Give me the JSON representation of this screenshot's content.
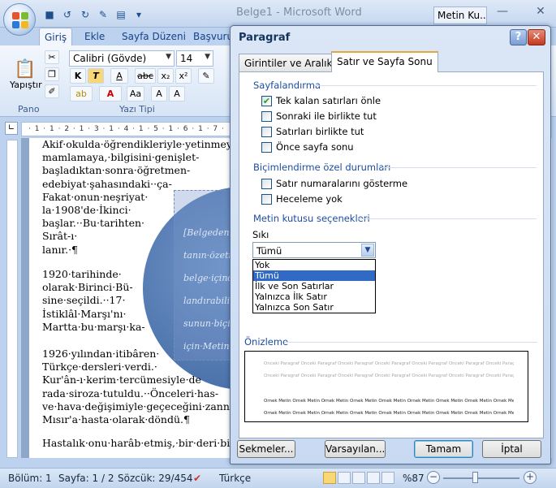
{
  "window": {
    "title": "Belge1 - Microsoft Word",
    "taskbar_label": "Metin Ku..."
  },
  "ribbon": {
    "tabs": [
      "Giriş",
      "Ekle",
      "Sayfa Düzeni",
      "Başvuru"
    ],
    "font_name": "Calibri (Gövde)",
    "font_size": "14",
    "paste_label": "Yapıştır",
    "group_clipboard": "Pano",
    "group_font": "Yazı Tipi"
  },
  "document": {
    "lines_a": [
      "Akif·okulda·öğrendikleriyle·yetinmeyerek",
      "mamlamaya,·bilgisini·genişlet-",
      "başladıktan·sonra·öğretmen-",
      "edebiyat·şahasındaki··ça-",
      "Fakat·onun·neşriyat·",
      "la·1908'de·İkinci·",
      "başlar.··Bu·tarihten·",
      "Sırât-ı·",
      "lanır.·¶"
    ],
    "lines_b": [
      "1920·tarihinde·",
      "olarak·Birinci·Bü-",
      "sine·seçildi.··17·",
      "İstiklâl·Marşı'nı·",
      "Martta·bu·marşı·ka-"
    ],
    "lines_c": [
      "1926·yılından·itibâren·",
      "Türkçe·dersleri·verdi.·",
      "Kur'ân-ı·kerim·tercümesiyle·de",
      "rada·siroza·tutuldu.··Önceleri·has-",
      "ve·hava·değişimiyle·geçeceğini·zannetti.·",
      "Mısır'a·hasta·olarak·döndü.¶"
    ],
    "line_d": "Hastalık·onu·harâb·etmiş,·bir·deri·bir·kem",
    "textbox_lines": [
      "[Belgeden·bi",
      "tanın·özetir",
      "belge·içinde",
      "landırabilirsi",
      "sunun·biçim",
      "için·Metin·K"
    ]
  },
  "status": {
    "section": "Bölüm: 1",
    "page": "Sayfa: 1 / 2",
    "words": "Sözcük: 29/454",
    "language": "Türkçe",
    "zoom": "%87",
    "zoom_level_percent": 87
  },
  "dialog": {
    "title": "Paragraf",
    "help_label": "?",
    "close_label": "✕",
    "tabs": [
      "Girintiler ve Aralıklar",
      "Satır ve Sayfa Sonu"
    ],
    "sec_pagination": "Sayfalandırma",
    "pagination": [
      {
        "label": "Tek kalan satırları önle",
        "checked": true
      },
      {
        "label": "Sonraki ile birlikte tut",
        "checked": false
      },
      {
        "label": "Satırları birlikte tut",
        "checked": false
      },
      {
        "label": "Önce sayfa sonu",
        "checked": false
      }
    ],
    "sec_formatting": "Biçimlendirme özel durumları",
    "formatting": [
      {
        "label": "Satır numaralarını gösterme",
        "checked": false
      },
      {
        "label": "Heceleme yok",
        "checked": false
      }
    ],
    "sec_textbox": "Metin kutusu seçenekleri",
    "tight_wrap_label": "Sıkı kaydırma:",
    "tight_wrap_value": "Tümü",
    "tight_wrap_options": [
      "Yok",
      "Tümü",
      "İlk ve Son Satırlar",
      "Yalnızca İlk Satır",
      "Yalnızca Son Satır"
    ],
    "tight_wrap_selected": 1,
    "sec_preview": "Önizleme",
    "preview_prev_text": "Önceki Paragraf Önceki Paragraf Önceki Paragraf Önceki Paragraf Önceki Paragraf Önceki Paragraf Önceki Paragraf Önceki Paragraf Önceki Paragraf Önceki Paragraf",
    "preview_sample_text": "Örnek Metin Örnek Metin Örnek Metin Örnek Metin Örnek Metin Örnek Metin Örnek Metin Örnek Metin Örnek Metin Örnek Metin Örnek Metin Örnek Metin",
    "buttons": {
      "tabs": "Sekmeler...",
      "defaults": "Varsayılan...",
      "ok": "Tamam",
      "cancel": "İptal"
    }
  }
}
